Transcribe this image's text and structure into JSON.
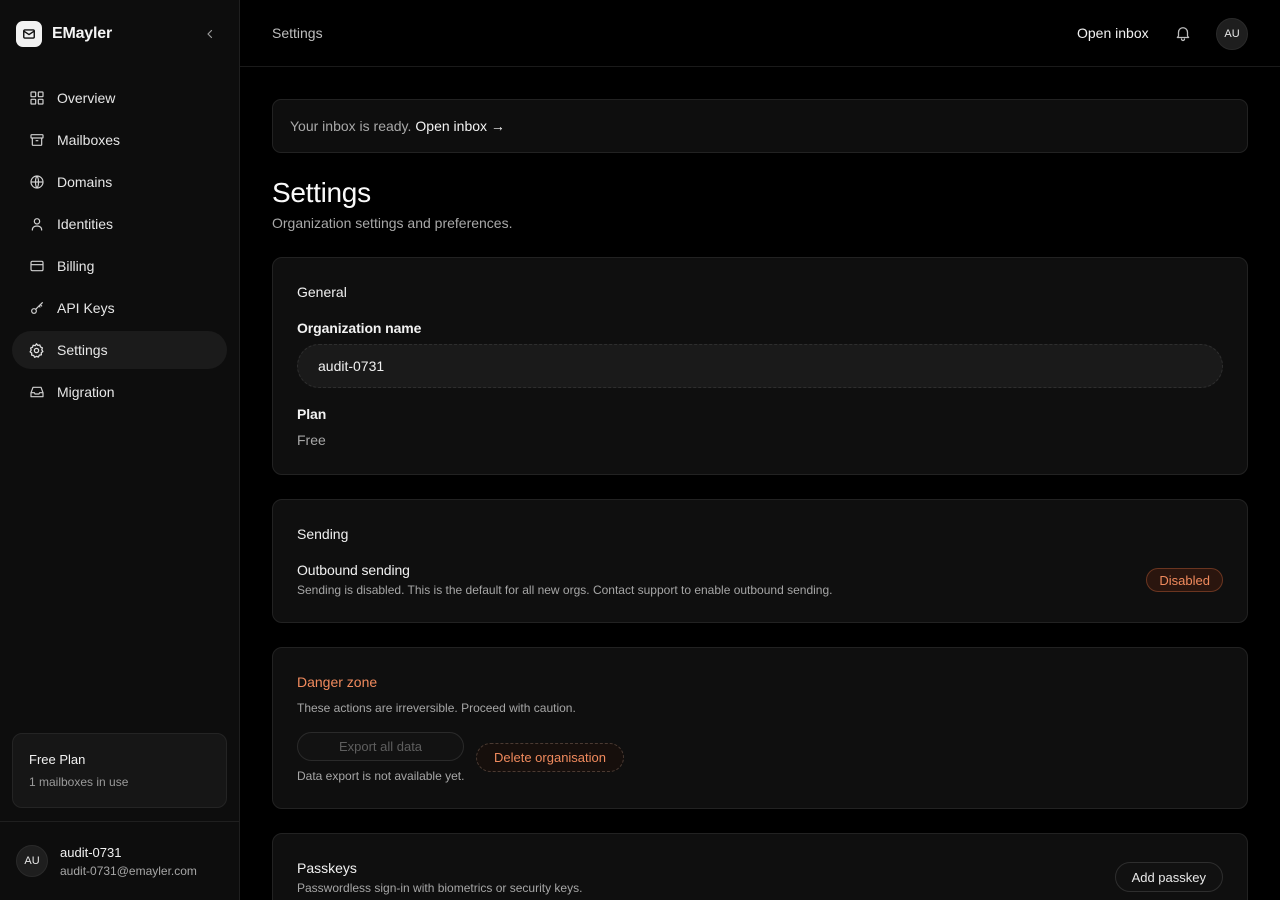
{
  "app": {
    "name": "EMayler"
  },
  "sidebar": {
    "items": [
      {
        "label": "Overview",
        "icon": "grid-icon"
      },
      {
        "label": "Mailboxes",
        "icon": "archive-icon"
      },
      {
        "label": "Domains",
        "icon": "globe-icon"
      },
      {
        "label": "Identities",
        "icon": "user-icon"
      },
      {
        "label": "Billing",
        "icon": "credit-card-icon"
      },
      {
        "label": "API Keys",
        "icon": "key-icon"
      },
      {
        "label": "Settings",
        "icon": "gear-icon",
        "active": true
      },
      {
        "label": "Migration",
        "icon": "inbox-icon"
      }
    ],
    "plan": {
      "title": "Free Plan",
      "usage": "1 mailboxes in use"
    },
    "user": {
      "initials": "AU",
      "name": "audit-0731",
      "email": "audit-0731@emayler.com"
    }
  },
  "header": {
    "breadcrumb": "Settings",
    "open_inbox": "Open inbox",
    "avatar_initials": "AU"
  },
  "banner": {
    "text": "Your inbox is ready.",
    "link": "Open inbox →"
  },
  "page": {
    "title": "Settings",
    "subtitle": "Organization settings and preferences."
  },
  "general": {
    "title": "General",
    "org_label": "Organization name",
    "org_value": "audit-0731",
    "plan_label": "Plan",
    "plan_value": "Free"
  },
  "sending": {
    "title": "Sending",
    "outbound_label": "Outbound sending",
    "outbound_desc": "Sending is disabled. This is the default for all new orgs. Contact support to enable outbound sending.",
    "status_badge": "Disabled"
  },
  "danger": {
    "title": "Danger zone",
    "desc": "These actions are irreversible. Proceed with caution.",
    "export_label": "Export all data",
    "export_note": "Data export is not available yet.",
    "delete_label": "Delete organisation"
  },
  "passkeys": {
    "title": "Passkeys",
    "desc": "Passwordless sign-in with biometrics or security keys.",
    "add_label": "Add passkey"
  },
  "colors": {
    "accent_danger": "#f08a5d",
    "background": "#000000",
    "card": "#0f0f0f"
  }
}
